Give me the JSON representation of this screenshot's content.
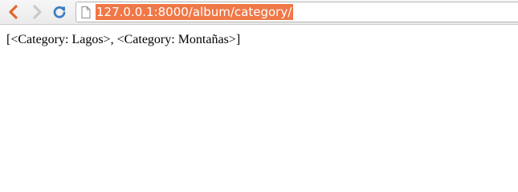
{
  "browser": {
    "url": "127.0.0.1:8000/album/category/",
    "icons": {
      "back": "chevron-left-icon",
      "forward": "chevron-right-icon",
      "reload": "reload-icon",
      "page": "page-icon"
    },
    "colors": {
      "url_selection": "#f07746",
      "back_arrow": "#e0662e",
      "reload": "#3d7ec4"
    }
  },
  "page": {
    "body_text": "[<Category: Lagos>, <Category: Montañas>]"
  }
}
